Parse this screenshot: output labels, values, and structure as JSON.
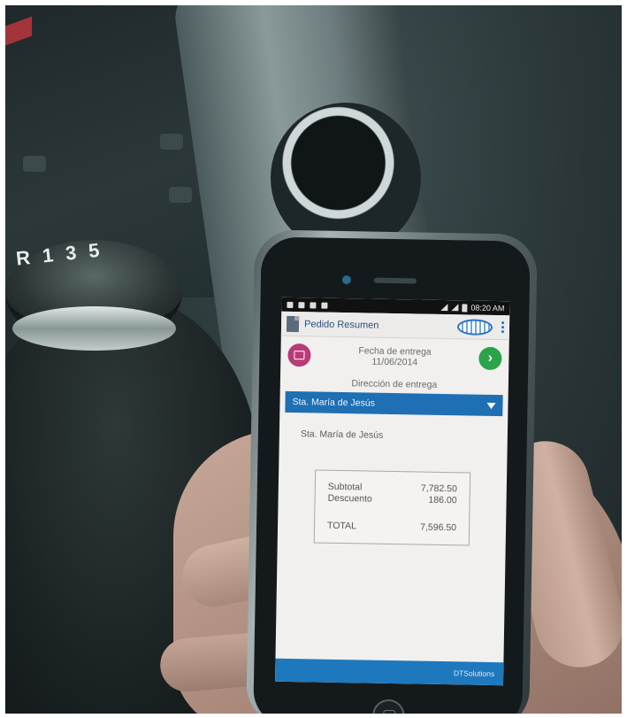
{
  "status_bar": {
    "time": "08:20 AM"
  },
  "app_bar": {
    "title": "Pedido Resumen"
  },
  "delivery": {
    "date_label": "Fecha de entrega",
    "date_value": "11/06/2014",
    "address_label": "Dirección de entrega",
    "address_selected": "Sta. María de Jesús",
    "address_text": "Sta. María de Jesús"
  },
  "totals": {
    "subtotal_label": "Subtotal",
    "subtotal_value": "7,782.50",
    "discount_label": "Descuento",
    "discount_value": "186.00",
    "total_label": "TOTAL",
    "total_value": "7,596.50"
  },
  "footer": {
    "brand": "DTSolutions"
  },
  "colors": {
    "primary_blue": "#1e6fb3",
    "calendar_magenta": "#b83a78",
    "next_green": "#2aa34a"
  }
}
